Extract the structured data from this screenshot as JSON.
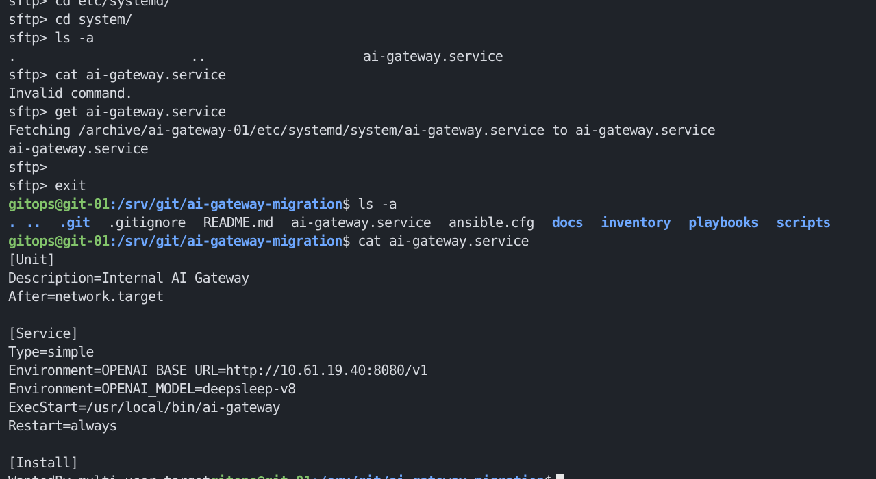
{
  "theme": {
    "background": "#1f2329",
    "foreground": "#d7dae0",
    "user_color": "#83c46b",
    "path_color": "#6ea8ff",
    "cursor_color": "#e6e6e6"
  },
  "prompt": {
    "user_host": "gitops@git-01",
    "path": ":/srv/git/ai-gateway-migration",
    "symbol": "$"
  },
  "sftp_session": {
    "line_partial_top": "sftp> cd etc/systemd/",
    "line_cd": "sftp> cd system/",
    "line_ls": "sftp> ls -a",
    "ls_entries": [
      ".",
      "..",
      "ai-gateway.service"
    ],
    "line_cat": "sftp> cat ai-gateway.service",
    "line_invalid": "Invalid command.",
    "line_get": "sftp> get ai-gateway.service",
    "line_fetching": "Fetching /archive/ai-gateway-01/etc/systemd/system/ai-gateway.service to ai-gateway.service",
    "line_progress": "ai-gateway.service",
    "line_empty_prompt": "sftp>",
    "line_exit": "sftp> exit"
  },
  "shell": {
    "cmd_ls": " ls -a",
    "ls_output": [
      {
        "name": ".",
        "type": "dir"
      },
      {
        "name": "..",
        "type": "dir"
      },
      {
        "name": ".git",
        "type": "dir"
      },
      {
        "name": ".gitignore",
        "type": "file"
      },
      {
        "name": "README.md",
        "type": "file"
      },
      {
        "name": "ai-gateway.service",
        "type": "file"
      },
      {
        "name": "ansible.cfg",
        "type": "file"
      },
      {
        "name": "docs",
        "type": "dir"
      },
      {
        "name": "inventory",
        "type": "dir"
      },
      {
        "name": "playbooks",
        "type": "dir"
      },
      {
        "name": "scripts",
        "type": "dir"
      }
    ],
    "cmd_cat": " cat ai-gateway.service"
  },
  "service_file": {
    "unit_header": "[Unit]",
    "description": "Description=Internal AI Gateway",
    "after": "After=network.target",
    "service_header": "[Service]",
    "type": "Type=simple",
    "env_base_url": "Environment=OPENAI_BASE_URL=http://10.61.19.40:8080/v1",
    "env_model": "Environment=OPENAI_MODEL=deepsleep-v8",
    "exec_start": "ExecStart=/usr/local/bin/ai-gateway",
    "restart": "Restart=always",
    "install_header": "[Install]",
    "wanted_by": "WantedBy=multi-user.target"
  }
}
